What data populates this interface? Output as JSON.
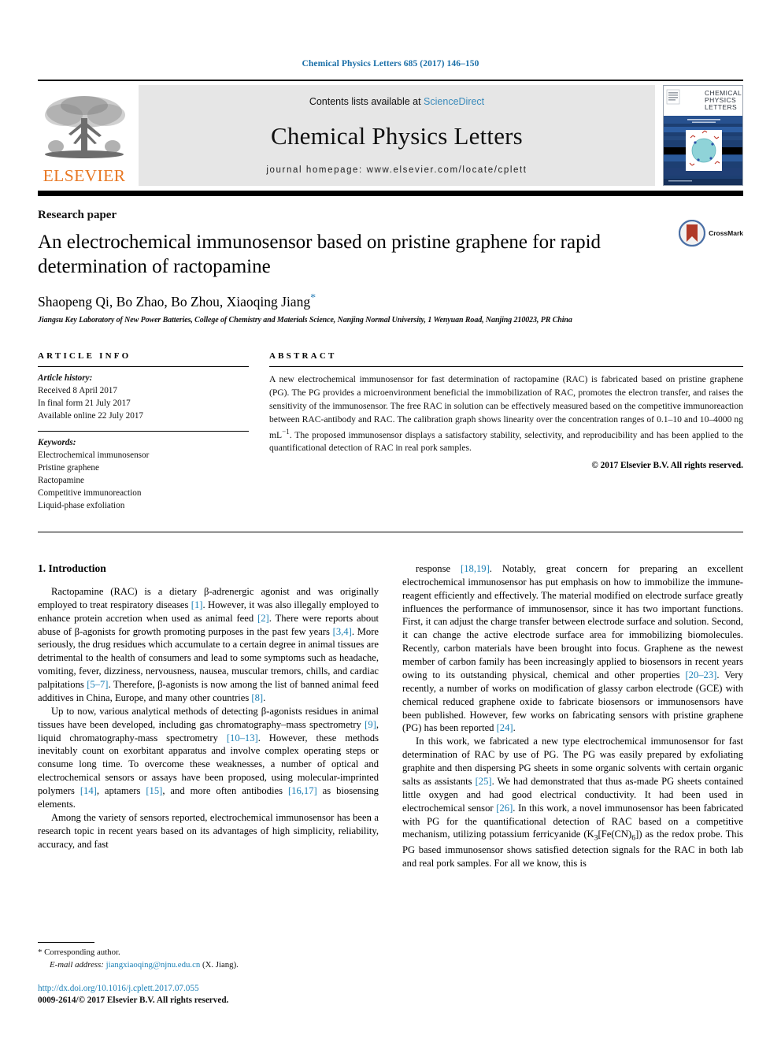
{
  "running_head": "Chemical Physics Letters 685 (2017) 146–150",
  "masthead": {
    "publisher_name": "ELSEVIER",
    "contents_prefix": "Contents lists available at ",
    "sciencedirect": "ScienceDirect",
    "journal_title": "Chemical Physics Letters",
    "homepage": "journal homepage: www.elsevier.com/locate/cplett",
    "cover": {
      "line1": "CHEMICAL",
      "line2": "PHYSICS",
      "line3": "LETTERS"
    }
  },
  "title_block": {
    "doctype": "Research paper",
    "title": "An electrochemical immunosensor based on pristine graphene for rapid determination of ractopamine",
    "authors": "Shaopeng Qi, Bo Zhao, Bo Zhou, Xiaoqing Jiang",
    "corresponding_marker": "*",
    "affiliation": "Jiangsu Key Laboratory of New Power Batteries, College of Chemistry and Materials Science, Nanjing Normal University, 1 Wenyuan Road, Nanjing 210023, PR China",
    "crossmark_label": "CrossMark"
  },
  "article_info": {
    "heading": "ARTICLE INFO",
    "history_label": "Article history:",
    "history": [
      "Received 8 April 2017",
      "In final form 21 July 2017",
      "Available online 22 July 2017"
    ],
    "keywords_label": "Keywords:",
    "keywords": [
      "Electrochemical immunosensor",
      "Pristine graphene",
      "Ractopamine",
      "Competitive immunoreaction",
      "Liquid-phase exfoliation"
    ]
  },
  "abstract": {
    "heading": "ABSTRACT",
    "text": "A new electrochemical immunosensor for fast determination of ractopamine (RAC) is fabricated based on pristine graphene (PG). The PG provides a microenvironment beneficial the immobilization of RAC, promotes the electron transfer, and raises the sensitivity of the immunosensor. The free RAC in solution can be effectively measured based on the competitive immunoreaction between RAC-antibody and RAC. The calibration graph shows linearity over the concentration ranges of 0.1–10 and 10–4000 ng mL−1. The proposed immunosensor displays a satisfactory stability, selectivity, and reproducibility and has been applied to the quantificational detection of RAC in real pork samples.",
    "copyright": "© 2017 Elsevier B.V. All rights reserved."
  },
  "body": {
    "section_number_title": "1. Introduction",
    "left_paragraphs": [
      "Ractopamine (RAC) is a dietary β-adrenergic agonist and was originally employed to treat respiratory diseases [1]. However, it was also illegally employed to enhance protein accretion when used as animal feed [2]. There were reports about abuse of β-agonists for growth promoting purposes in the past few years [3,4]. More seriously, the drug residues which accumulate to a certain degree in animal tissues are detrimental to the health of consumers and lead to some symptoms such as headache, vomiting, fever, dizziness, nervousness, nausea, muscular tremors, chills, and cardiac palpitations [5–7]. Therefore, β-agonists is now among the list of banned animal feed additives in China, Europe, and many other countries [8].",
      "Up to now, various analytical methods of detecting β-agonists residues in animal tissues have been developed, including gas chromatography–mass spectrometry [9], liquid chromatography-mass spectrometry [10–13]. However, these methods inevitably count on exorbitant apparatus and involve complex operating steps or consume long time. To overcome these weaknesses, a number of optical and electrochemical sensors or assays have been proposed, using molecular-imprinted polymers [14], aptamers [15], and more often antibodies [16,17] as biosensing elements.",
      "Among the variety of sensors reported, electrochemical immunosensor has been a research topic in recent years based on its advantages of high simplicity, reliability, accuracy, and fast"
    ],
    "right_paragraphs": [
      "response [18,19]. Notably, great concern for preparing an excellent electrochemical immunosensor has put emphasis on how to immobilize the immune-reagent efficiently and effectively. The material modified on electrode surface greatly influences the performance of immunosensor, since it has two important functions. First, it can adjust the charge transfer between electrode surface and solution. Second, it can change the active electrode surface area for immobilizing biomolecules. Recently, carbon materials have been brought into focus. Graphene as the newest member of carbon family has been increasingly applied to biosensors in recent years owing to its outstanding physical, chemical and other properties [20–23]. Very recently, a number of works on modification of glassy carbon electrode (GCE) with chemical reduced graphene oxide to fabricate biosensors or immunosensors have been published. However, few works on fabricating sensors with pristine graphene (PG) has been reported [24].",
      "In this work, we fabricated a new type electrochemical immunosensor for fast determination of RAC by use of PG. The PG was easily prepared by exfoliating graphite and then dispersing PG sheets in some organic solvents with certain organic salts as assistants [25]. We had demonstrated that thus as-made PG sheets contained little oxygen and had good electrical conductivity. It had been used in electrochemical sensor [26]. In this work, a novel immunosensor has been fabricated with PG for the quantificational detection of RAC based on a competitive mechanism, utilizing potassium ferricyanide (K3[Fe(CN)6]) as the redox probe. This PG based immunosensor shows satisfied detection signals for the RAC in both lab and real pork samples. For all we know, this is"
    ]
  },
  "footnote": {
    "corresponding_symbol": "*",
    "corresponding_text": "Corresponding author.",
    "email_label": "E-mail address:",
    "email": "jiangxiaoqing@njnu.edu.cn",
    "email_suffix": "(X. Jiang).",
    "doi": "http://dx.doi.org/10.1016/j.cplett.2017.07.055",
    "issn_line": "0009-2614/© 2017 Elsevier B.V. All rights reserved."
  },
  "colors": {
    "link": "#1a7fb5",
    "elsevier_orange": "#E87722",
    "running_head": "#1a6fa8"
  }
}
